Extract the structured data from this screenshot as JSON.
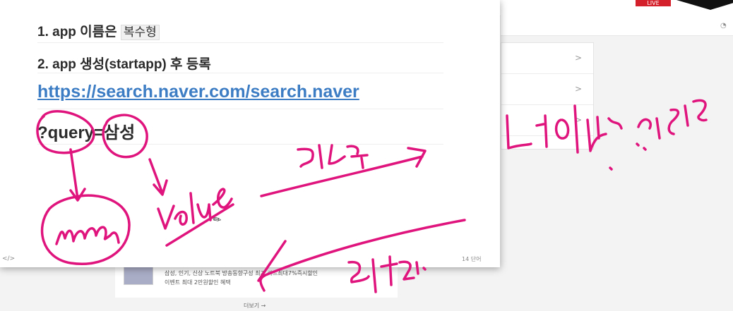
{
  "background": {
    "live_badge": "LIVE",
    "chevrons": [
      ">",
      ">",
      ">"
    ],
    "card_line1": "삼성, 인기, 신상 노트북 방송동향구성 최가 카드최대7%즉시할인",
    "card_line2": "이벤트  최대 2만원할인 혜택",
    "more_link": "더보기 →"
  },
  "editor": {
    "line1_prefix": "1. app 이름은",
    "line1_code": "복수형",
    "line2": "2. app 생성(startapp) 후 등록",
    "line3_link": "https://search.naver.com/search.naver",
    "line4": "?query=삼성",
    "status_left": "</>",
    "word_count": "14 단어"
  },
  "colors": {
    "ink": "#e0147d",
    "link": "#3d7dc4"
  },
  "icons": {
    "pen_cursor": "pen-cursor-icon"
  }
}
